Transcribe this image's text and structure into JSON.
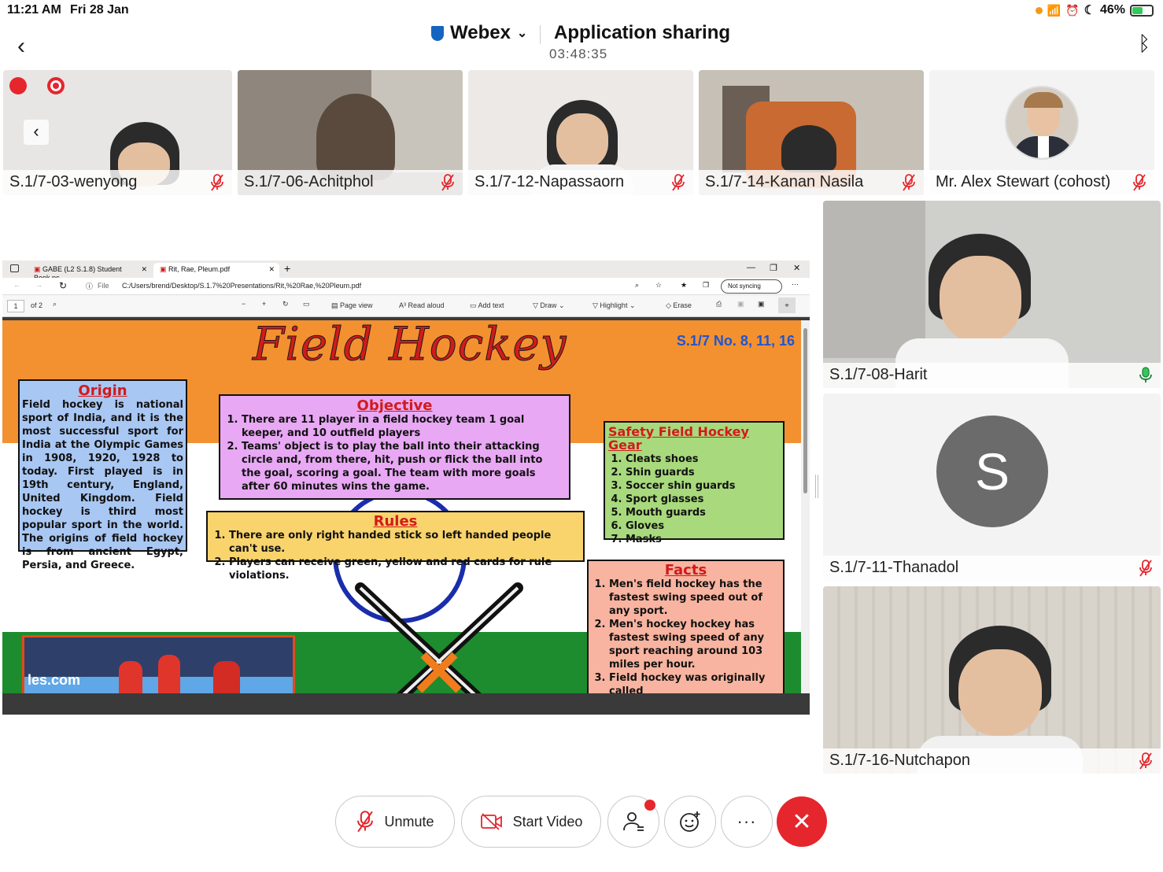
{
  "status_bar": {
    "time": "11:21 AM",
    "date": "Fri 28 Jan",
    "battery": "46%"
  },
  "meeting": {
    "app": "Webex",
    "title": "Application sharing",
    "timer": "03:48:35"
  },
  "participants_top": [
    {
      "name": "S.1/7-03-wenyong"
    },
    {
      "name": "S.1/7-06-Achitphol"
    },
    {
      "name": "S.1/7-12-Napassaorn"
    },
    {
      "name": "S.1/7-14-Kanan Nasila"
    },
    {
      "name": "Mr. Alex Stewart (cohost)"
    }
  ],
  "participants_side": [
    {
      "name": "S.1/7-08-Harit"
    },
    {
      "name": "S.1/7-11-Thanadol",
      "initial": "S"
    },
    {
      "name": "S.1/7-16-Nutchapon"
    }
  ],
  "browser": {
    "tabs": [
      "GABE (L2 S.1.8) Student Book.pc",
      "Rit, Rae, Pleum.pdf"
    ],
    "address": "C:/Users/brend/Desktop/S.1.7%20Presentations/Rit,%20Rae,%20Pleum.pdf",
    "file_label": "File",
    "sync_label": "Not syncing",
    "page_num": "1",
    "page_of": "of 2",
    "tools": [
      "Page view",
      "Read aloud",
      "Add text",
      "Draw",
      "Highlight",
      "Erase"
    ]
  },
  "poster": {
    "title": "Field Hockey",
    "class_label": "S.1/7 No. 8, 11, 16",
    "origin": {
      "heading": "Origin",
      "text": "Field hockey is national sport of India, and it is the most successful sport for India at the Olympic Games in 1908, 1920, 1928 to today. First played is in 19th century, England, United Kingdom. Field hockey is third most popular sport in the world. The origins of field hockey is from ancient Egypt, Persia, and Greece."
    },
    "objective": {
      "heading": "Objective",
      "items": [
        "There are 11 player in a field hockey team 1 goal keeper, and 10 outfield players",
        "Teams' object is to play the ball into their attacking circle and, from there, hit, push or flick the ball into the goal, scoring a goal. The team with more goals after 60 minutes wins the game."
      ]
    },
    "rules": {
      "heading": "Rules",
      "items": [
        "There are only right handed stick so left handed people can't use.",
        "Players can receive green, yellow and red cards for rule violations."
      ]
    },
    "safety": {
      "heading": "Safety Field Hockey Gear",
      "items": [
        "Cleats shoes",
        "Shin guards",
        "Soccer shin guards",
        "Sport glasses",
        "Mouth guards",
        "Gloves",
        "Masks"
      ]
    },
    "facts": {
      "heading": "Facts",
      "items": [
        "Men's field hockey has the fastest swing speed out of any sport.",
        "Men's hockey hockey has fastest swing speed of any sport reaching around 103 miles per hour.",
        "Field hockey was originally called"
      ]
    },
    "photo_text": "les.com"
  },
  "controls": {
    "unmute": "Unmute",
    "start_video": "Start Video",
    "more": "···"
  }
}
